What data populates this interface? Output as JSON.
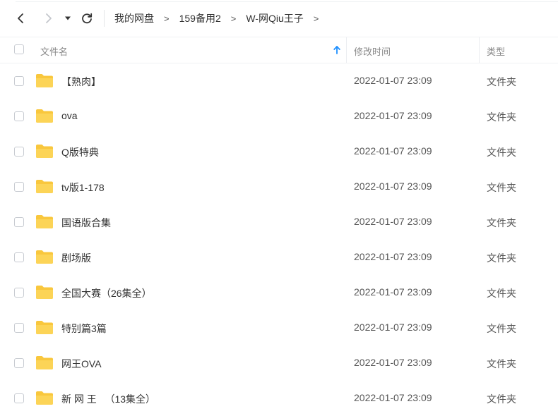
{
  "breadcrumb": [
    "我的网盘",
    "159备用2",
    "W-网Qiu王子"
  ],
  "header": {
    "name": "文件名",
    "time": "修改时间",
    "type": "类型",
    "sort_icon": "arrow-up-icon",
    "sort_color": "#1e90ff"
  },
  "icons": {
    "back": "chevron-left-icon",
    "forward": "chevron-right-icon",
    "dropdown": "caret-down-icon",
    "refresh": "refresh-icon",
    "folder": "folder-icon"
  },
  "colors": {
    "folder": "#f9c73d"
  },
  "files": [
    {
      "name": "【熟肉】",
      "time": "2022-01-07 23:09",
      "type": "文件夹"
    },
    {
      "name": "ova",
      "time": "2022-01-07 23:09",
      "type": "文件夹"
    },
    {
      "name": "Q版特典",
      "time": "2022-01-07 23:09",
      "type": "文件夹"
    },
    {
      "name": "tv版1-178",
      "time": "2022-01-07 23:09",
      "type": "文件夹"
    },
    {
      "name": "国语版合集",
      "time": "2022-01-07 23:09",
      "type": "文件夹"
    },
    {
      "name": "剧场版",
      "time": "2022-01-07 23:09",
      "type": "文件夹"
    },
    {
      "name": "全国大赛（26集全）",
      "time": "2022-01-07 23:09",
      "type": "文件夹"
    },
    {
      "name": "特别篇3篇",
      "time": "2022-01-07 23:09",
      "type": "文件夹"
    },
    {
      "name": "网王OVA",
      "time": "2022-01-07 23:09",
      "type": "文件夹"
    },
    {
      "name": "新 网 王   （13集全）",
      "time": "2022-01-07 23:09",
      "type": "文件夹"
    }
  ]
}
